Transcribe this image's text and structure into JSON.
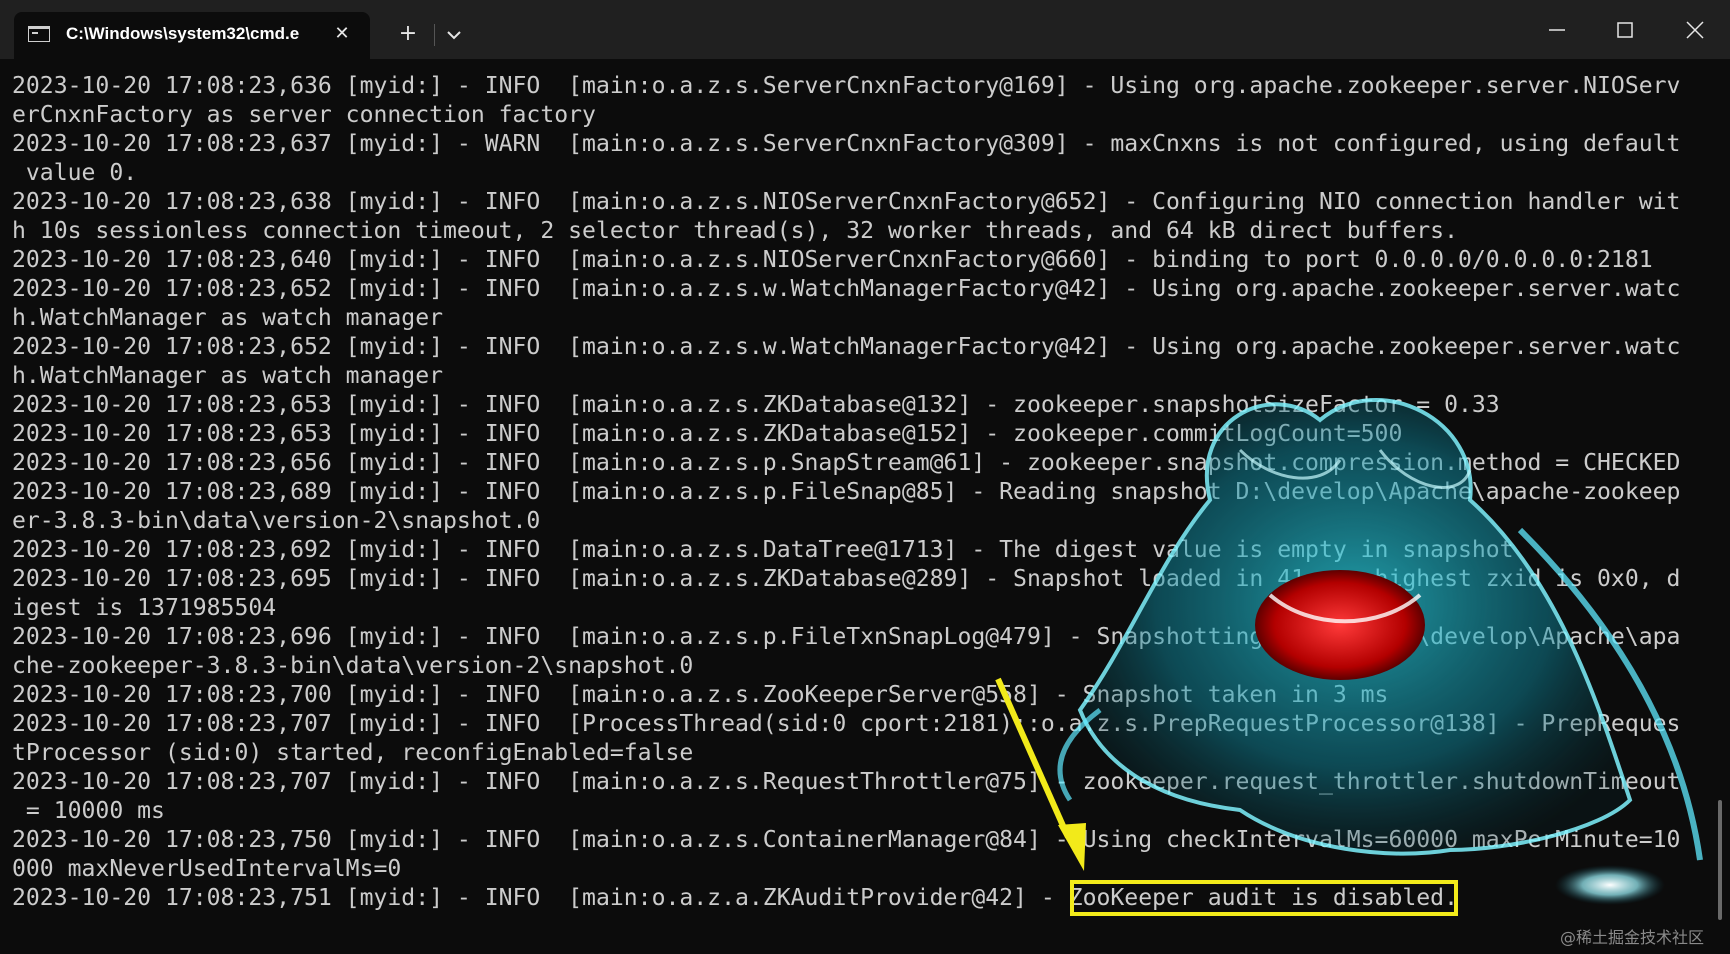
{
  "window": {
    "tab_title": "C:\\Windows\\system32\\cmd.e",
    "new_tab_symbol": "+",
    "close_symbol": "✕"
  },
  "terminal": {
    "lines": [
      "2023-10-20 17:08:23,636 [myid:] - INFO  [main:o.a.z.s.ServerCnxnFactory@169] - Using org.apache.zookeeper.server.NIOServ",
      "erCnxnFactory as server connection factory",
      "2023-10-20 17:08:23,637 [myid:] - WARN  [main:o.a.z.s.ServerCnxnFactory@309] - maxCnxns is not configured, using default",
      " value 0.",
      "2023-10-20 17:08:23,638 [myid:] - INFO  [main:o.a.z.s.NIOServerCnxnFactory@652] - Configuring NIO connection handler wit",
      "h 10s sessionless connection timeout, 2 selector thread(s), 32 worker threads, and 64 kB direct buffers.",
      "2023-10-20 17:08:23,640 [myid:] - INFO  [main:o.a.z.s.NIOServerCnxnFactory@660] - binding to port 0.0.0.0/0.0.0.0:2181",
      "2023-10-20 17:08:23,652 [myid:] - INFO  [main:o.a.z.s.w.WatchManagerFactory@42] - Using org.apache.zookeeper.server.watc",
      "h.WatchManager as watch manager",
      "2023-10-20 17:08:23,652 [myid:] - INFO  [main:o.a.z.s.w.WatchManagerFactory@42] - Using org.apache.zookeeper.server.watc",
      "h.WatchManager as watch manager",
      "2023-10-20 17:08:23,653 [myid:] - INFO  [main:o.a.z.s.ZKDatabase@132] - zookeeper.snapshotSizeFactor = 0.33",
      "2023-10-20 17:08:23,653 [myid:] - INFO  [main:o.a.z.s.ZKDatabase@152] - zookeeper.commitLogCount=500",
      "2023-10-20 17:08:23,656 [myid:] - INFO  [main:o.a.z.s.p.SnapStream@61] - zookeeper.snapshot.compression.method = CHECKED",
      "2023-10-20 17:08:23,689 [myid:] - INFO  [main:o.a.z.s.p.FileSnap@85] - Reading snapshot D:\\develop\\Apache\\apache-zookeep",
      "er-3.8.3-bin\\data\\version-2\\snapshot.0",
      "2023-10-20 17:08:23,692 [myid:] - INFO  [main:o.a.z.s.DataTree@1713] - The digest value is empty in snapshot",
      "2023-10-20 17:08:23,695 [myid:] - INFO  [main:o.a.z.s.ZKDatabase@289] - Snapshot loaded in 41 ms, highest zxid is 0x0, d",
      "igest is 1371985504",
      "2023-10-20 17:08:23,696 [myid:] - INFO  [main:o.a.z.s.p.FileTxnSnapLog@479] - Snapshotting: 0x0 to D:\\develop\\Apache\\apa",
      "che-zookeeper-3.8.3-bin\\data\\version-2\\snapshot.0",
      "2023-10-20 17:08:23,700 [myid:] - INFO  [main:o.a.z.s.ZooKeeperServer@558] - Snapshot taken in 3 ms",
      "2023-10-20 17:08:23,707 [myid:] - INFO  [ProcessThread(sid:0 cport:2181)::o.a.z.s.PrepRequestProcessor@138] - PrepReques",
      "tProcessor (sid:0) started, reconfigEnabled=false",
      "2023-10-20 17:08:23,707 [myid:] - INFO  [main:o.a.z.s.RequestThrottler@75] - zookeeper.request_throttler.shutdownTimeout",
      " = 10000 ms",
      "2023-10-20 17:08:23,750 [myid:] - INFO  [main:o.a.z.s.ContainerManager@84] - Using checkIntervalMs=60000 maxPerMinute=10",
      "000 maxNeverUsedIntervalMs=0",
      "2023-10-20 17:08:23,751 [myid:] - INFO  [main:o.a.z.a.ZKAuditProvider@42] - ZooKeeper audit is disabled."
    ]
  },
  "annotation": {
    "highlight_color": "#f2ea1a"
  },
  "watermark": "@稀土掘金技术社区",
  "colors": {
    "terminal_bg": "#0c0c0c",
    "terminal_fg": "#cccccc",
    "titlebar_bg": "#202020"
  }
}
